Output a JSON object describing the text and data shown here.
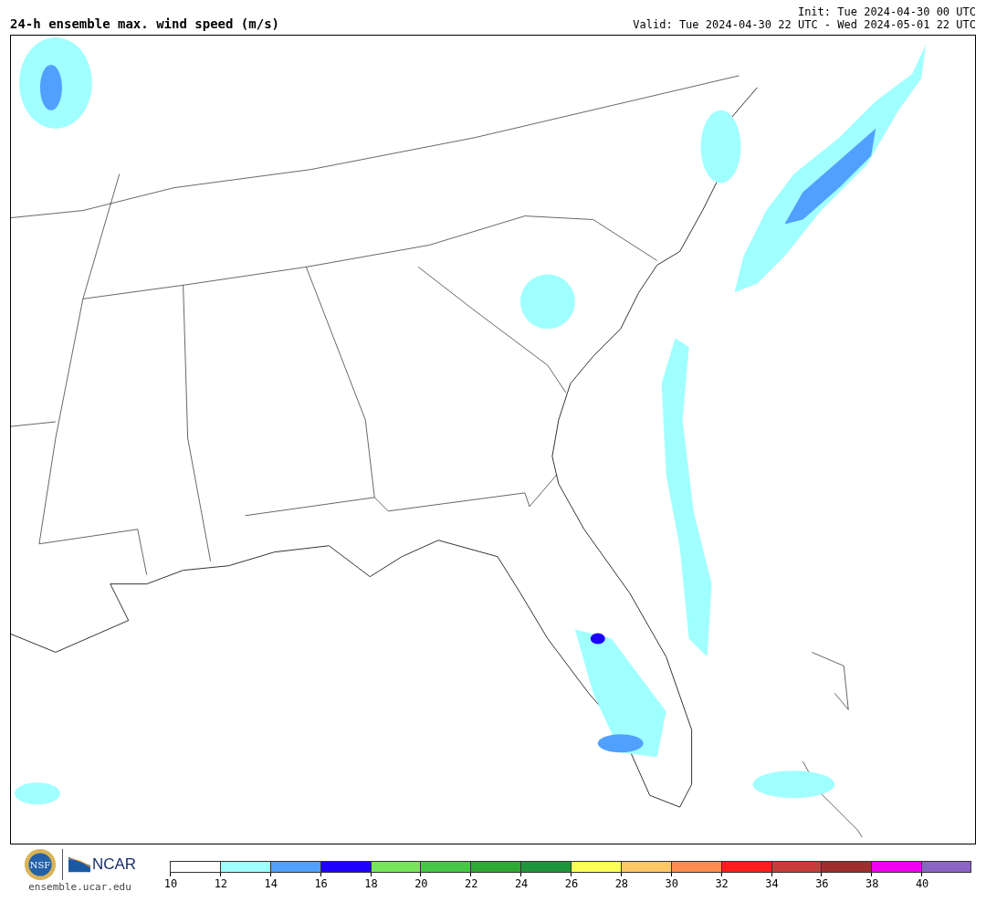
{
  "title": "24-h ensemble max. wind speed (m/s)",
  "init": "Init: Tue 2024-04-30 00 UTC",
  "valid": "Valid: Tue 2024-04-30 22 UTC - Wed 2024-05-01 22 UTC",
  "logos": {
    "nsf": "NSF",
    "ncar": "NCAR",
    "url": "ensemble.ucar.edu"
  },
  "colorbar": [
    {
      "color": "#ffffff",
      "label": "10"
    },
    {
      "color": "#a0ffff",
      "label": "12"
    },
    {
      "color": "#50a0ff",
      "label": "14"
    },
    {
      "color": "#1e00ff",
      "label": "16"
    },
    {
      "color": "#78e65a",
      "label": "18"
    },
    {
      "color": "#46c846",
      "label": "20"
    },
    {
      "color": "#2daa32",
      "label": "22"
    },
    {
      "color": "#1e963c",
      "label": "24"
    },
    {
      "color": "#ffff5a",
      "label": "26"
    },
    {
      "color": "#ffc864",
      "label": "28"
    },
    {
      "color": "#ff8c50",
      "label": "30"
    },
    {
      "color": "#ff1e1e",
      "label": "32"
    },
    {
      "color": "#c83c3c",
      "label": "34"
    },
    {
      "color": "#a02d2d",
      "label": "36"
    },
    {
      "color": "#f000f0",
      "label": "38"
    },
    {
      "color": "#8c64c8",
      "label": "40"
    }
  ]
}
